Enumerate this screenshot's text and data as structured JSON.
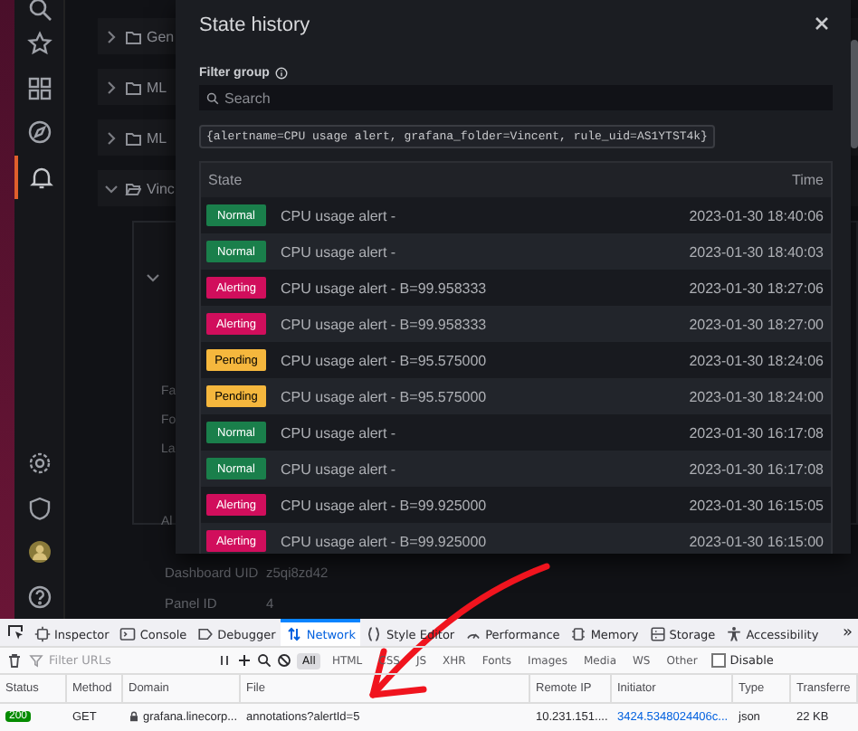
{
  "sidebar": {
    "items": [
      {
        "kind": "search",
        "selected": false
      },
      {
        "kind": "star",
        "selected": false
      },
      {
        "kind": "grid",
        "selected": false
      },
      {
        "kind": "compass",
        "selected": false
      },
      {
        "kind": "bell",
        "selected": true
      },
      {
        "kind": "gap",
        "selected": false
      },
      {
        "kind": "gear",
        "selected": false
      },
      {
        "kind": "shield",
        "selected": false
      },
      {
        "kind": "avatar",
        "selected": false
      },
      {
        "kind": "help",
        "selected": false
      }
    ]
  },
  "folders": [
    {
      "label": "Gen",
      "expanded": false
    },
    {
      "label": "ML",
      "expanded": false
    },
    {
      "label": "ML",
      "expanded": false
    },
    {
      "label": "Vinc",
      "expanded": true
    }
  ],
  "panel_labels": [
    "Fa",
    "Fo",
    "La",
    "Al"
  ],
  "details": [
    {
      "label": "Dashboard UID",
      "value": "z5qi8zd42"
    },
    {
      "label": "Panel ID",
      "value": "4"
    }
  ],
  "dialog": {
    "title": "State history",
    "filter_label": "Filter group",
    "search_placeholder": "Search",
    "label_filter": "{alertname=CPU usage alert, grafana_folder=Vincent, rule_uid=AS1YTST4k}",
    "columns": [
      "State",
      "Time"
    ],
    "rows": [
      {
        "kind": "normal",
        "state": "Normal",
        "text": "CPU usage alert -",
        "time": "2023-01-30 18:40:06"
      },
      {
        "kind": "normal",
        "state": "Normal",
        "text": "CPU usage alert -",
        "time": "2023-01-30 18:40:03"
      },
      {
        "kind": "alerting",
        "state": "Alerting",
        "text": "CPU usage alert - B=99.958333",
        "time": "2023-01-30 18:27:06"
      },
      {
        "kind": "alerting",
        "state": "Alerting",
        "text": "CPU usage alert - B=99.958333",
        "time": "2023-01-30 18:27:00"
      },
      {
        "kind": "pending",
        "state": "Pending",
        "text": "CPU usage alert - B=95.575000",
        "time": "2023-01-30 18:24:06"
      },
      {
        "kind": "pending",
        "state": "Pending",
        "text": "CPU usage alert - B=95.575000",
        "time": "2023-01-30 18:24:00"
      },
      {
        "kind": "normal",
        "state": "Normal",
        "text": "CPU usage alert -",
        "time": "2023-01-30 16:17:08"
      },
      {
        "kind": "normal",
        "state": "Normal",
        "text": "CPU usage alert -",
        "time": "2023-01-30 16:17:08"
      },
      {
        "kind": "alerting",
        "state": "Alerting",
        "text": "CPU usage alert - B=99.925000",
        "time": "2023-01-30 16:15:05"
      },
      {
        "kind": "alerting",
        "state": "Alerting",
        "text": "CPU usage alert - B=99.925000",
        "time": "2023-01-30 16:15:00"
      }
    ]
  },
  "devtools": {
    "tabs": [
      {
        "kind": "inspector",
        "label": "Inspector",
        "selected": false
      },
      {
        "kind": "console",
        "label": "Console",
        "selected": false
      },
      {
        "kind": "debugger",
        "label": "Debugger",
        "selected": false
      },
      {
        "kind": "network",
        "label": "Network",
        "selected": true
      },
      {
        "kind": "style",
        "label": "Style Editor",
        "selected": false
      },
      {
        "kind": "performance",
        "label": "Performance",
        "selected": false
      },
      {
        "kind": "memory",
        "label": "Memory",
        "selected": false
      },
      {
        "kind": "storage",
        "label": "Storage",
        "selected": false
      },
      {
        "kind": "accessibility",
        "label": "Accessibility",
        "selected": false
      }
    ],
    "more": "»",
    "filter_placeholder": "Filter URLs",
    "type_filters": [
      {
        "label": "All",
        "selected": true
      },
      {
        "label": "HTML",
        "selected": false
      },
      {
        "label": "CSS",
        "selected": false
      },
      {
        "label": "JS",
        "selected": false
      },
      {
        "label": "XHR",
        "selected": false
      },
      {
        "label": "Fonts",
        "selected": false
      },
      {
        "label": "Images",
        "selected": false
      },
      {
        "label": "Media",
        "selected": false
      },
      {
        "label": "WS",
        "selected": false
      },
      {
        "label": "Other",
        "selected": false
      }
    ],
    "disable_cache": {
      "label": "Disable",
      "checked": false
    },
    "columns": [
      "Status",
      "Method",
      "Domain",
      "File",
      "Remote IP",
      "Initiator",
      "Type",
      "Transferre"
    ],
    "requests": [
      {
        "status": "200",
        "method": "GET",
        "domain": "grafana.linecorp...",
        "file": "annotations?alertId=5",
        "remote_ip": "10.231.151....",
        "initiator": "3424.5348024406c...",
        "type": "json",
        "transferred": "22 KB"
      }
    ]
  }
}
